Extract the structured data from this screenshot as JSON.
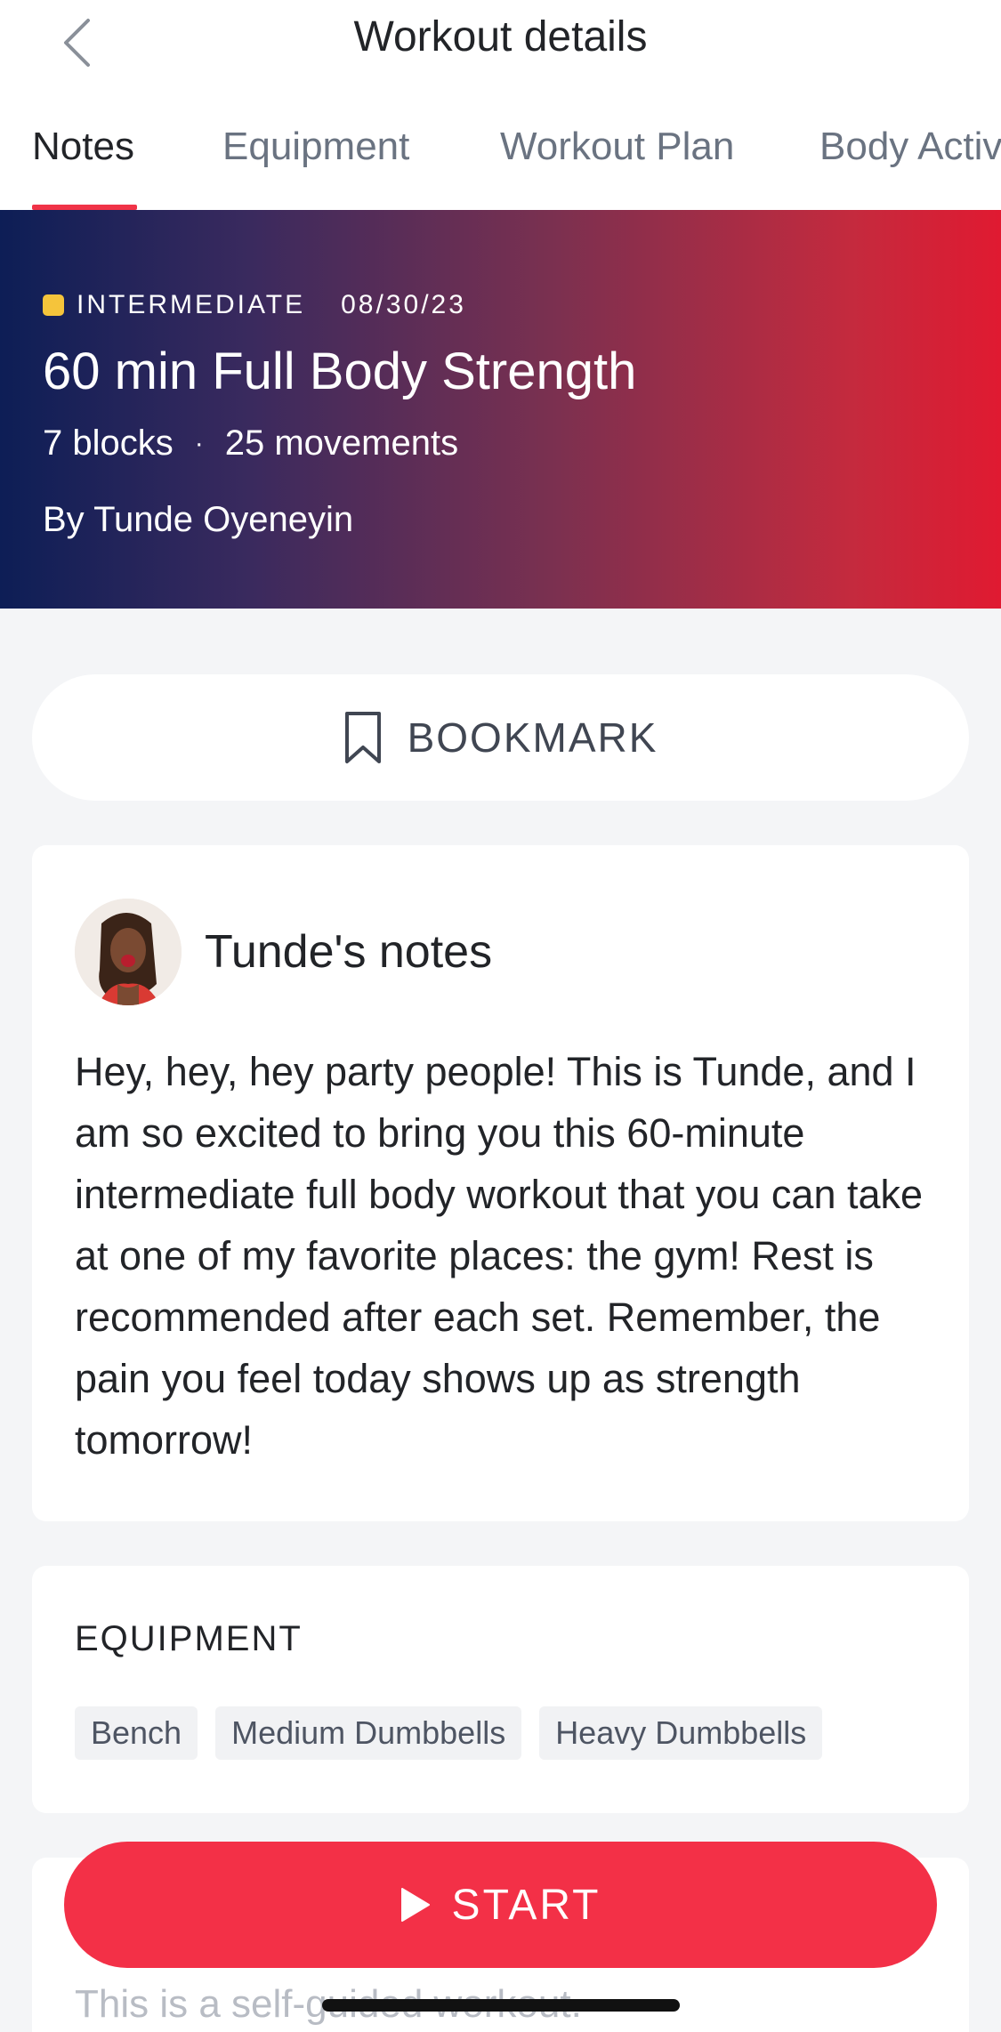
{
  "header": {
    "title": "Workout details"
  },
  "tabs": [
    {
      "label": "Notes",
      "active": true
    },
    {
      "label": "Equipment",
      "active": false
    },
    {
      "label": "Workout Plan",
      "active": false
    },
    {
      "label": "Body Activ",
      "active": false
    }
  ],
  "hero": {
    "level": "INTERMEDIATE",
    "date": "08/30/23",
    "title": "60 min Full Body Strength",
    "blocks": "7 blocks",
    "separator": "·",
    "movements": "25 movements",
    "author": "By Tunde Oyeneyin",
    "level_color": "#f5c43b"
  },
  "bookmark": {
    "label": "BOOKMARK",
    "icon": "bookmark-icon"
  },
  "notes": {
    "title": "Tunde's notes",
    "body": "Hey, hey, hey party people! This is Tunde, and I am so excited to bring you this 60-minute intermediate full body workout that you can take at one of my favorite places: the gym! Rest is recommended after each set. Remember, the pain you feel today shows up as strength tomorrow!"
  },
  "equipment": {
    "heading": "EQUIPMENT",
    "items": [
      "Bench",
      "Medium Dumbbells",
      "Heavy Dumbbells"
    ]
  },
  "next_section": {
    "text": "This is a self-guided workout."
  },
  "start": {
    "label": "START",
    "icon": "play-icon"
  },
  "colors": {
    "accent": "#f33047",
    "tab_underline": "#f03347"
  }
}
